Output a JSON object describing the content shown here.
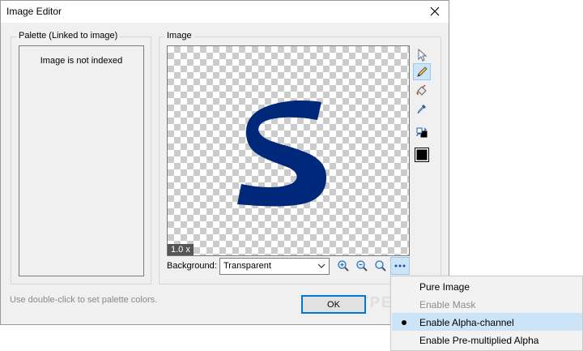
{
  "window": {
    "title": "Image Editor"
  },
  "palette": {
    "group_title": "Palette (Linked to image)",
    "message": "Image is not indexed"
  },
  "image": {
    "group_title": "Image",
    "zoom": "1.0 x",
    "glyph_color": "#00287a"
  },
  "tools": [
    "select-tool",
    "pencil-tool",
    "fill-tool",
    "eyedropper-tool",
    "swap-colors-tool",
    "color-swatch"
  ],
  "background": {
    "label": "Background:",
    "value": "Transparent"
  },
  "hint": "Use double-click to set palette colors.",
  "ok_label": "OK",
  "watermark": "SOFTPEDIA",
  "menu": {
    "items": [
      {
        "label": "Pure Image",
        "checked": false,
        "enabled": true
      },
      {
        "label": "Enable Mask",
        "checked": false,
        "enabled": false
      },
      {
        "label": "Enable Alpha-channel",
        "checked": true,
        "enabled": true
      },
      {
        "label": "Enable Pre-multiplied Alpha",
        "checked": false,
        "enabled": true
      }
    ]
  },
  "colors": {
    "accent": "#0078d7",
    "selection": "#cce4f7"
  }
}
